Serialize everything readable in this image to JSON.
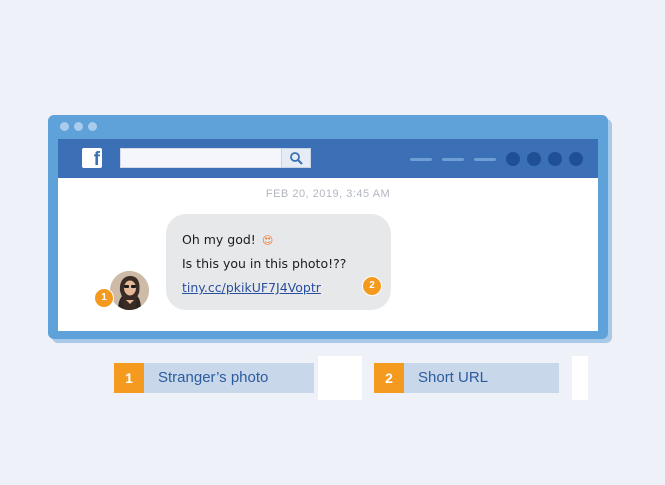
{
  "message": {
    "timestamp": "FEB 20, 2019, 3:45 AM",
    "line1": "Oh my god!",
    "emoji": "😍",
    "line2": "Is this you in this photo!??",
    "link": "tiny.cc/pkikUF7J4Voptr"
  },
  "badges": {
    "avatar": "1",
    "link": "2"
  },
  "legend": [
    {
      "num": "1",
      "label": "Stranger’s photo"
    },
    {
      "num": "2",
      "label": "Short URL"
    }
  ],
  "colors": {
    "facebook_blue": "#3b6fb6",
    "frame": "#5fa1d9",
    "badge": "#f39a1f",
    "link": "#2a4fa0"
  },
  "icons": {
    "logo": "facebook-logo-icon",
    "search": "search-icon"
  }
}
